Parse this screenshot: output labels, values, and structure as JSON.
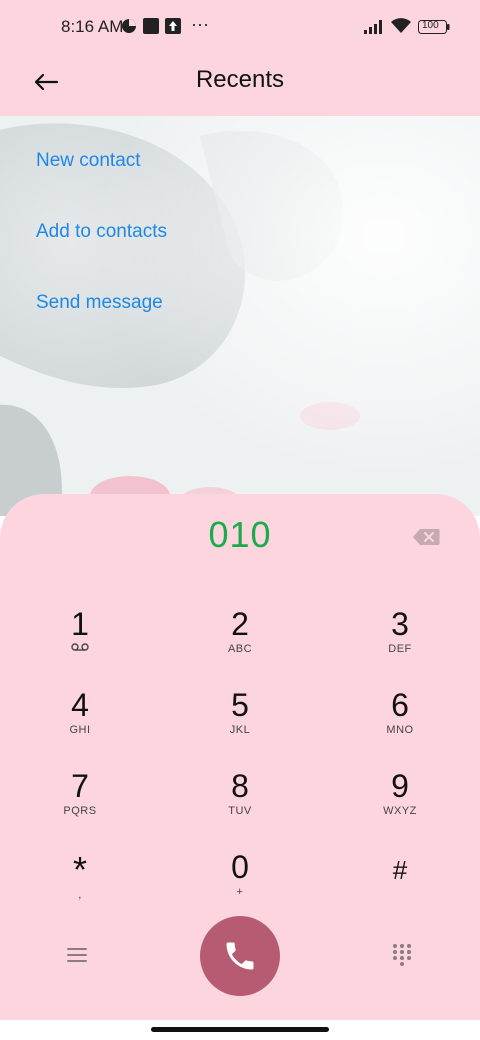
{
  "status_bar": {
    "time": "8:16 AM",
    "battery": "100",
    "more": "···",
    "icons": [
      "data-saver-icon",
      "square-notification-icon",
      "upload-notification-icon",
      "signal-icon",
      "wifi-icon",
      "battery-icon"
    ]
  },
  "header": {
    "title": "Recents",
    "back_icon": "arrow-left-icon"
  },
  "actions": {
    "new_contact": "New contact",
    "add_to_contacts": "Add to contacts",
    "send_message": "Send message"
  },
  "dialer": {
    "number": "010",
    "keys": [
      {
        "digit": "1",
        "sub": ""
      },
      {
        "digit": "2",
        "sub": "ABC"
      },
      {
        "digit": "3",
        "sub": "DEF"
      },
      {
        "digit": "4",
        "sub": "GHI"
      },
      {
        "digit": "5",
        "sub": "JKL"
      },
      {
        "digit": "6",
        "sub": "MNO"
      },
      {
        "digit": "7",
        "sub": "PQRS"
      },
      {
        "digit": "8",
        "sub": "TUV"
      },
      {
        "digit": "9",
        "sub": "WXYZ"
      },
      {
        "digit": "*",
        "sub": ","
      },
      {
        "digit": "0",
        "sub": "+"
      },
      {
        "digit": "#",
        "sub": ""
      }
    ]
  },
  "colors": {
    "sheet": "#fdd5df",
    "accent_link": "#1e88e5",
    "number": "#1aab4a",
    "call_button": "#b75b72"
  }
}
